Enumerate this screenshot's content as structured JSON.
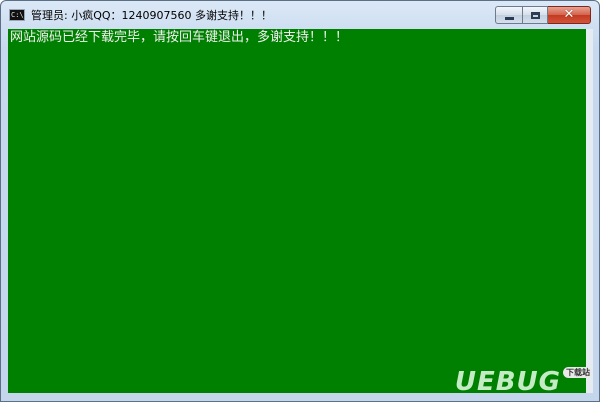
{
  "window": {
    "title": "管理员:  小疯QQ：1240907560 多谢支持！！！",
    "icon": "console-icon",
    "icon_text": "C:\\_"
  },
  "controls": {
    "minimize_icon": "minimize-icon",
    "maximize_icon": "maximize-icon",
    "close_icon": "close-icon",
    "close_glyph": "✕"
  },
  "console": {
    "output": "网站源码已经下载完毕，请按回车键退出，多谢支持！！！",
    "background": "#008000",
    "foreground": "#f0f0f0"
  },
  "watermark": {
    "text": "UEBUG",
    "sub": "下载站"
  }
}
